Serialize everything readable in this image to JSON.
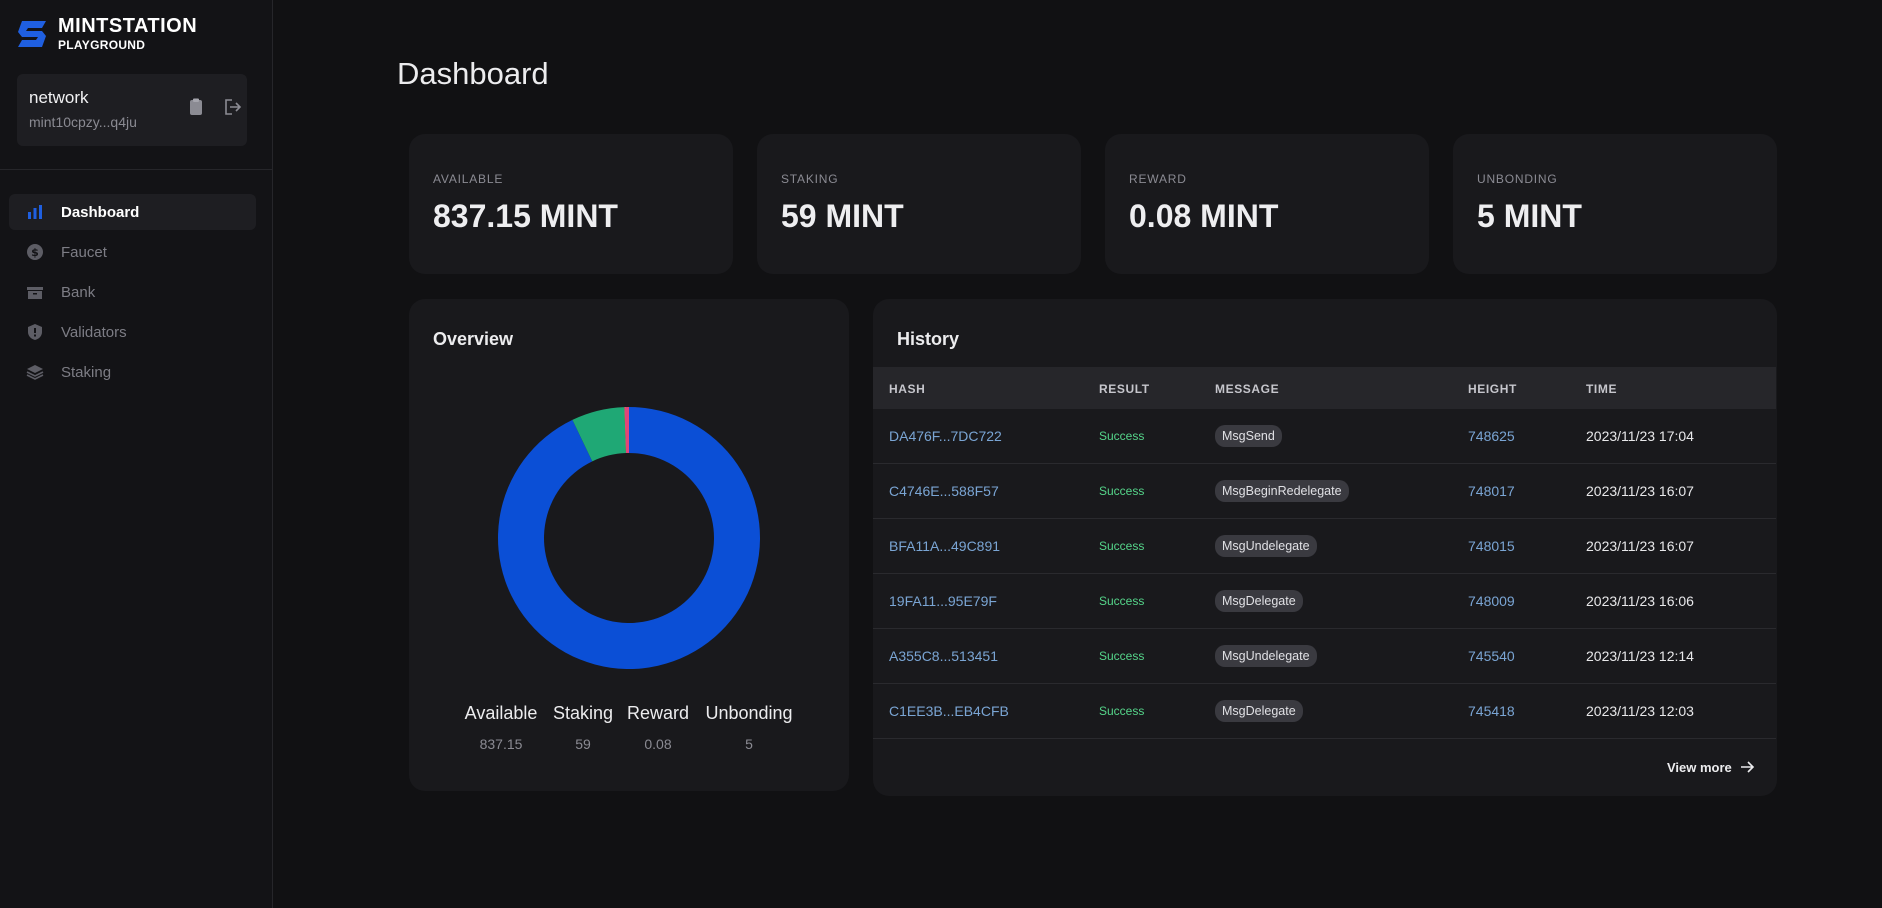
{
  "brand": {
    "name": "MINTSTATION",
    "sub": "PLAYGROUND"
  },
  "wallet": {
    "name": "network",
    "address": "mint10cpzy...q4ju"
  },
  "nav": [
    {
      "label": "Dashboard",
      "icon": "bar-chart-icon",
      "active": true
    },
    {
      "label": "Faucet",
      "icon": "dollar-coin-icon",
      "active": false
    },
    {
      "label": "Bank",
      "icon": "bank-icon",
      "active": false
    },
    {
      "label": "Validators",
      "icon": "shield-icon",
      "active": false
    },
    {
      "label": "Staking",
      "icon": "layers-icon",
      "active": false
    }
  ],
  "page": {
    "title": "Dashboard"
  },
  "stats": [
    {
      "label": "AVAILABLE",
      "value": "837.15 MINT"
    },
    {
      "label": "STAKING",
      "value": "59 MINT"
    },
    {
      "label": "REWARD",
      "value": "0.08 MINT"
    },
    {
      "label": "UNBONDING",
      "value": "5 MINT"
    }
  ],
  "overview": {
    "title": "Overview",
    "legend": [
      {
        "label": "Available",
        "value": "837.15"
      },
      {
        "label": "Staking",
        "value": "59"
      },
      {
        "label": "Reward",
        "value": "0.08"
      },
      {
        "label": "Unbonding",
        "value": "5"
      }
    ]
  },
  "chart_data": {
    "type": "pie",
    "categories": [
      "Available",
      "Staking",
      "Reward",
      "Unbonding"
    ],
    "values": [
      837.15,
      59,
      0.08,
      5
    ],
    "colors": [
      "#0b4fd6",
      "#1fa875",
      "#f5b800",
      "#e0457b"
    ],
    "donut": true
  },
  "history": {
    "title": "History",
    "columns": [
      "HASH",
      "RESULT",
      "MESSAGE",
      "HEIGHT",
      "TIME"
    ],
    "rows": [
      {
        "hash": "DA476F...7DC722",
        "result": "Success",
        "message": "MsgSend",
        "height": "748625",
        "time": "2023/11/23 17:04"
      },
      {
        "hash": "C4746E...588F57",
        "result": "Success",
        "message": "MsgBeginRedelegate",
        "height": "748017",
        "time": "2023/11/23 16:07"
      },
      {
        "hash": "BFA11A...49C891",
        "result": "Success",
        "message": "MsgUndelegate",
        "height": "748015",
        "time": "2023/11/23 16:07"
      },
      {
        "hash": "19FA11...95E79F",
        "result": "Success",
        "message": "MsgDelegate",
        "height": "748009",
        "time": "2023/11/23 16:06"
      },
      {
        "hash": "A355C8...513451",
        "result": "Success",
        "message": "MsgUndelegate",
        "height": "745540",
        "time": "2023/11/23 12:14"
      },
      {
        "hash": "C1EE3B...EB4CFB",
        "result": "Success",
        "message": "MsgDelegate",
        "height": "745418",
        "time": "2023/11/23 12:03"
      }
    ],
    "view_more": "View more"
  },
  "colors": {
    "accent": "#1f5fe0",
    "success": "#55d58a",
    "link": "#7aa5d4",
    "background": "#111113",
    "card": "#19191c"
  }
}
